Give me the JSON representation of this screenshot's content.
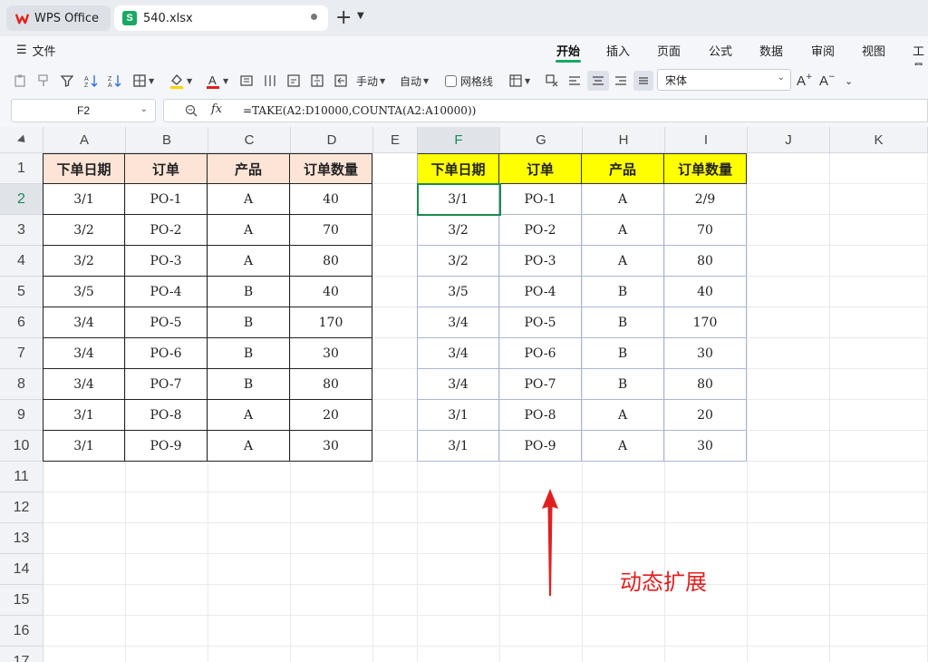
{
  "tabs": [
    {
      "label": "WPS Office"
    },
    {
      "label": "540.xlsx"
    }
  ],
  "ribbon": {
    "file_label": "文件",
    "tabs": [
      "开始",
      "插入",
      "页面",
      "公式",
      "数据",
      "审阅",
      "视图",
      "工具"
    ],
    "active_tab": "开始"
  },
  "toolbar": {
    "manual_label": "手动",
    "auto_label": "自动",
    "gridlines_label": "网格线",
    "font_name": "宋体"
  },
  "formula_bar": {
    "cell_ref": "F2",
    "fx_label": "fx",
    "formula": "=TAKE(A2:D10000,COUNTA(A2:A10000))"
  },
  "grid": {
    "columns": [
      "A",
      "B",
      "C",
      "D",
      "E",
      "F",
      "G",
      "H",
      "I",
      "J",
      "K"
    ],
    "selected_column": "F",
    "rows": [
      "1",
      "2",
      "3",
      "4",
      "5",
      "6",
      "7",
      "8",
      "9",
      "10",
      "11",
      "12",
      "13",
      "14",
      "15",
      "16",
      "17"
    ],
    "selected_row": "2"
  },
  "source_table": {
    "headers": [
      "下单日期",
      "订单",
      "产品",
      "订单数量"
    ],
    "rows": [
      [
        "3/1",
        "PO-1",
        "A",
        "40"
      ],
      [
        "3/2",
        "PO-2",
        "A",
        "70"
      ],
      [
        "3/2",
        "PO-3",
        "A",
        "80"
      ],
      [
        "3/5",
        "PO-4",
        "B",
        "40"
      ],
      [
        "3/4",
        "PO-5",
        "B",
        "170"
      ],
      [
        "3/4",
        "PO-6",
        "B",
        "30"
      ],
      [
        "3/4",
        "PO-7",
        "B",
        "80"
      ],
      [
        "3/1",
        "PO-8",
        "A",
        "20"
      ],
      [
        "3/1",
        "PO-9",
        "A",
        "30"
      ]
    ],
    "header_color": "#fce4d6"
  },
  "result_table": {
    "headers": [
      "下单日期",
      "订单",
      "产品",
      "订单数量"
    ],
    "rows": [
      [
        "3/1",
        "PO-1",
        "A",
        "2/9"
      ],
      [
        "3/2",
        "PO-2",
        "A",
        "70"
      ],
      [
        "3/2",
        "PO-3",
        "A",
        "80"
      ],
      [
        "3/5",
        "PO-4",
        "B",
        "40"
      ],
      [
        "3/4",
        "PO-5",
        "B",
        "170"
      ],
      [
        "3/4",
        "PO-6",
        "B",
        "30"
      ],
      [
        "3/4",
        "PO-7",
        "B",
        "80"
      ],
      [
        "3/1",
        "PO-8",
        "A",
        "20"
      ],
      [
        "3/1",
        "PO-9",
        "A",
        "30"
      ]
    ],
    "header_color": "#ffff00"
  },
  "annotation": {
    "text": "动态扩展",
    "color": "#e02020"
  },
  "colors": {
    "accent": "#1aa864"
  }
}
